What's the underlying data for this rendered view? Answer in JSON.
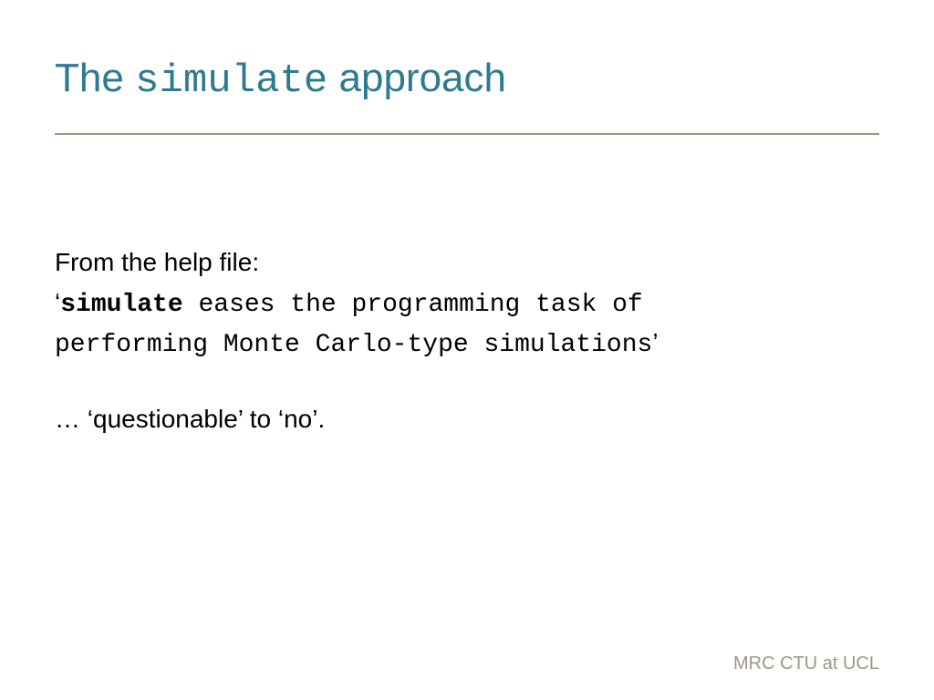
{
  "title": {
    "prefix": "The ",
    "mono": "simulate",
    "suffix": " approach"
  },
  "body": {
    "intro": "From the help file:",
    "quote_open": "‘",
    "quote_bold": "simulate",
    "quote_rest1": " eases the programming task of",
    "quote_rest2": "performing Monte Carlo-type simulations",
    "quote_close": "’",
    "conclusion": "… ‘questionable’ to ‘no’."
  },
  "footer": "MRC CTU at UCL",
  "colors": {
    "accent": "#2e7a8f",
    "divider": "#9e9683",
    "footer": "#9e9683"
  }
}
